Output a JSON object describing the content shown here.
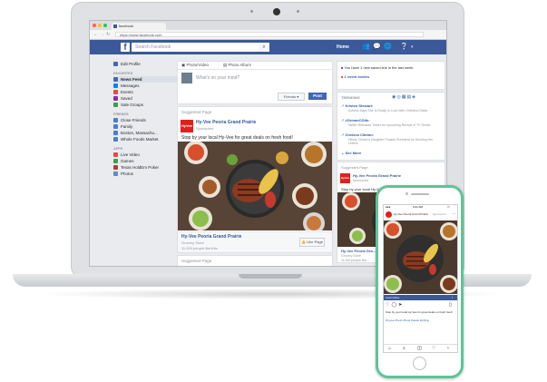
{
  "browser": {
    "tab_title": "facebook",
    "url": "https://www.facebook.com",
    "back": "←",
    "forward": "→",
    "reload": "↻"
  },
  "header": {
    "logo": "f",
    "search_placeholder": "Search Facebook",
    "search_icon": "search-icon",
    "home": "Home",
    "icons": [
      "friends-icon",
      "messages-icon",
      "globe-icon",
      "help-icon"
    ],
    "brand_color": "#3b5998"
  },
  "sidebar": {
    "edit_profile": "Edit Profile",
    "favorites_title": "FAVORITES",
    "favorites": [
      {
        "label": "News Feed",
        "color": "#4267b2"
      },
      {
        "label": "Messages",
        "color": "#0084ff"
      },
      {
        "label": "Events",
        "color": "#e04b4b"
      },
      {
        "label": "Saved",
        "color": "#8b2d9c"
      },
      {
        "label": "Sale Groups",
        "color": "#3c9e49"
      }
    ],
    "friends_title": "FRIENDS",
    "friends": [
      {
        "label": "Close Friends",
        "color": "#4b7ecb"
      },
      {
        "label": "Family",
        "color": "#4b7ecb"
      },
      {
        "label": "Boston, Massachu...",
        "color": "#4b7ecb"
      },
      {
        "label": "Whole Foods Market",
        "color": "#4b7ecb"
      }
    ],
    "apps_title": "APPS",
    "apps": [
      {
        "label": "Live Video",
        "color": "#e04b4b"
      },
      {
        "label": "Games",
        "color": "#3c9e49"
      },
      {
        "label": "Texas HoldEm Poker",
        "color": "#b23b3b"
      },
      {
        "label": "Photos",
        "color": "#5b8ccb"
      }
    ]
  },
  "composer": {
    "tab_photo_video": "Photo/Video",
    "tab_photo_album": "Photo Album",
    "prompt": "What's on your mind?",
    "audience": "Friends ▾",
    "post_button": "Post"
  },
  "ad": {
    "suggested": "Suggested Page",
    "logo_text": "HyVee",
    "page_name": "Hy-Vee Peoria Grand Prairie",
    "sponsored": "Sponsored",
    "text": "Stop by your local Hy-Vee for great deals on fresh food!",
    "footer_name": "Hy-Vee Peoria Grand Prairie",
    "footer_category": "Grocery Store",
    "footer_likes": "11,000 people like this.",
    "like_page": "Like Page",
    "suggested_2": "Suggested Page"
  },
  "right": {
    "saved_line": "You have 1 new saved link in the last week",
    "event_line": "1 event invites",
    "trending_title": "TRENDING",
    "trending": [
      {
        "name": "Kristen Stewart:",
        "desc": "Actress Says She Is Really in Love With Girlfriend Stella"
      },
      {
        "name": "#GrimmCGifs:",
        "desc": "Netflix Releases Trailer for Upcoming Revival of TV Series"
      },
      {
        "name": "Chelsea Clinton:",
        "desc": "Hillary Clinton's Daughter Praises President for Sending Her Letters"
      }
    ],
    "see_more": "See More",
    "suggested": "Suggested Page",
    "page_name": "Hy-Vee Peoria Grand Prairie",
    "sponsored": "Sponsored",
    "text": "Stop by your local Hy-Vee for great deals on fresh food!",
    "footer_name": "Hy-Vee Peoria Gra...",
    "footer_category": "Grocery Store",
    "footer_likes": "11,000 people like..."
  },
  "phone": {
    "time": "9:41 AM",
    "page_name": "Hy-Vee Peoria Grand Prairie",
    "sponsored": "Sponsored",
    "learn_more": "Learn More",
    "caption": "Stop by your local Hy-Vee for great deals on fresh food!",
    "hashtags": "#hyvee #fresh #food #deals #grilling",
    "accent": "#5dc596",
    "nav_icons": [
      "home-icon",
      "search-icon",
      "camera-icon",
      "heart-icon",
      "profile-icon"
    ]
  }
}
